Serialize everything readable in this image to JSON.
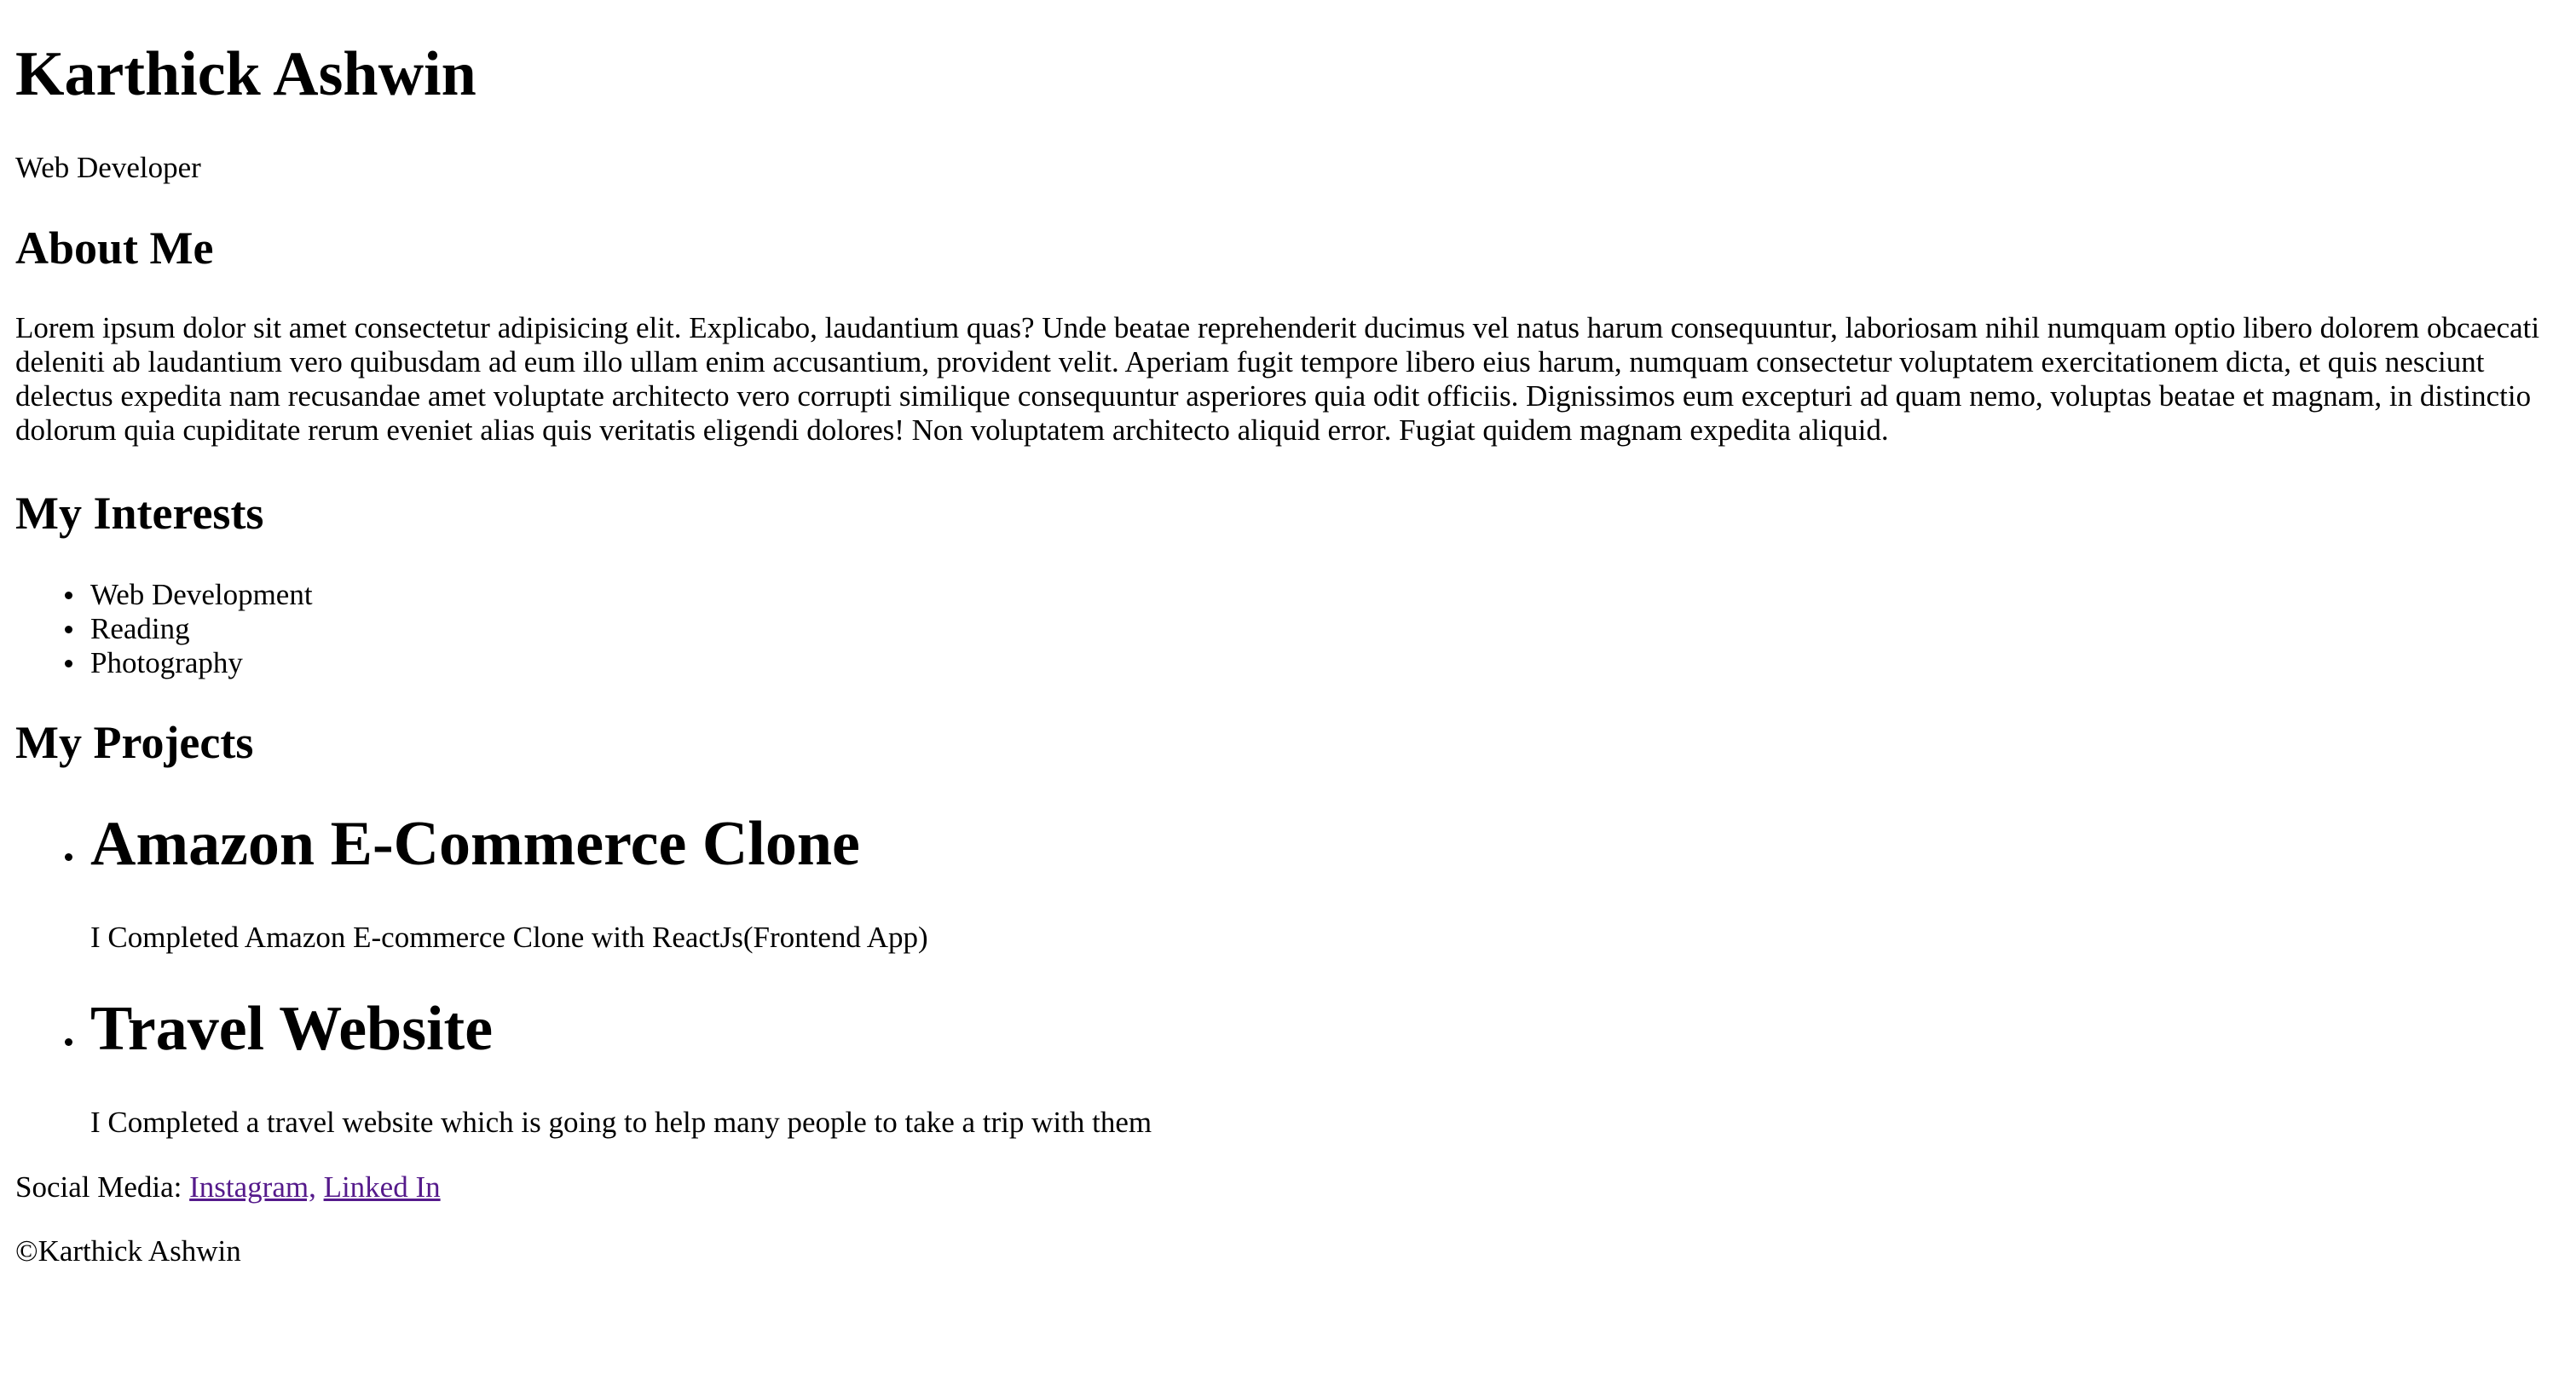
{
  "header": {
    "name": "Karthick Ashwin",
    "role": "Web Developer"
  },
  "about": {
    "heading": "About Me",
    "text": "Lorem ipsum dolor sit amet consectetur adipisicing elit. Explicabo, laudantium quas? Unde beatae reprehenderit ducimus vel natus harum consequuntur, laboriosam nihil numquam optio libero dolorem obcaecati deleniti ab laudantium vero quibusdam ad eum illo ullam enim accusantium, provident velit. Aperiam fugit tempore libero eius harum, numquam consectetur voluptatem exercitationem dicta, et quis nesciunt delectus expedita nam recusandae amet voluptate architecto vero corrupti similique consequuntur asperiores quia odit officiis. Dignissimos eum excepturi ad quam nemo, voluptas beatae et magnam, in distinctio dolorum quia cupiditate rerum eveniet alias quis veritatis eligendi dolores! Non voluptatem architecto aliquid error. Fugiat quidem magnam expedita aliquid."
  },
  "interests": {
    "heading": "My Interests",
    "items": [
      "Web Development",
      "Reading",
      "Photography"
    ]
  },
  "projects": {
    "heading": "My Projects",
    "items": [
      {
        "title": "Amazon E-Commerce Clone",
        "description": "I Completed Amazon E-commerce Clone with ReactJs(Frontend App)"
      },
      {
        "title": "Travel Website",
        "description": "I Completed a travel website which is going to help many people to take a trip with them"
      }
    ]
  },
  "social": {
    "label": "Social Media: ",
    "links": [
      {
        "text": "Instagram,"
      },
      {
        "text": "Linked In"
      }
    ]
  },
  "footer": {
    "copyright": "©Karthick Ashwin"
  },
  "colors": {
    "text": "#000000",
    "visited_link": "#551a8b",
    "background": "#ffffff"
  }
}
